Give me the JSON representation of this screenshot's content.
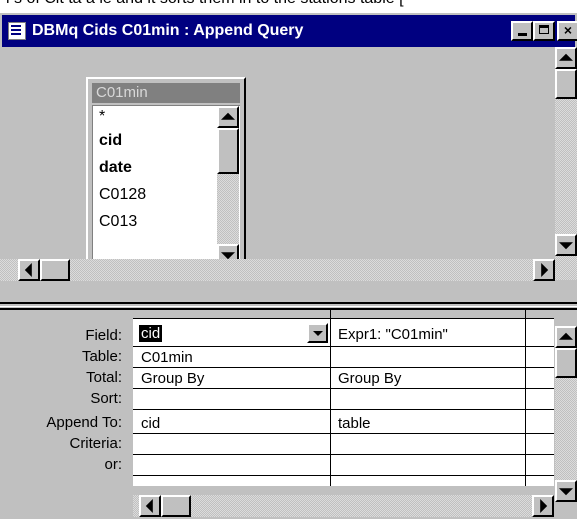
{
  "background_text": "i s of Cit ta a ie and it sorts them in to the stations table [",
  "window": {
    "title": "DBMq Cids C01min : Append Query",
    "controls": {
      "minimize": "_",
      "maximize": "□",
      "close": "×"
    }
  },
  "field_list": {
    "title": "C01min",
    "items": [
      {
        "label": "*",
        "bold": false
      },
      {
        "label": "cid",
        "bold": true
      },
      {
        "label": "date",
        "bold": true
      },
      {
        "label": "C0128",
        "bold": false
      },
      {
        "label": "C013",
        "bold": false
      }
    ]
  },
  "grid": {
    "row_labels": [
      "Field:",
      "Table:",
      "Total:",
      "Sort:",
      "Append To:",
      "Criteria:",
      "or:"
    ],
    "columns": [
      {
        "field": "cid",
        "table": "C01min",
        "total": "Group By",
        "sort": "",
        "append_to": "cid",
        "criteria": "",
        "or": ""
      },
      {
        "field": "Expr1: \"C01min\"",
        "table": "",
        "total": "Group By",
        "sort": "",
        "append_to": "table",
        "criteria": "",
        "or": ""
      }
    ]
  },
  "colors": {
    "titlebar": "#000080",
    "face": "#c0c0c0",
    "selection": "#000000"
  }
}
